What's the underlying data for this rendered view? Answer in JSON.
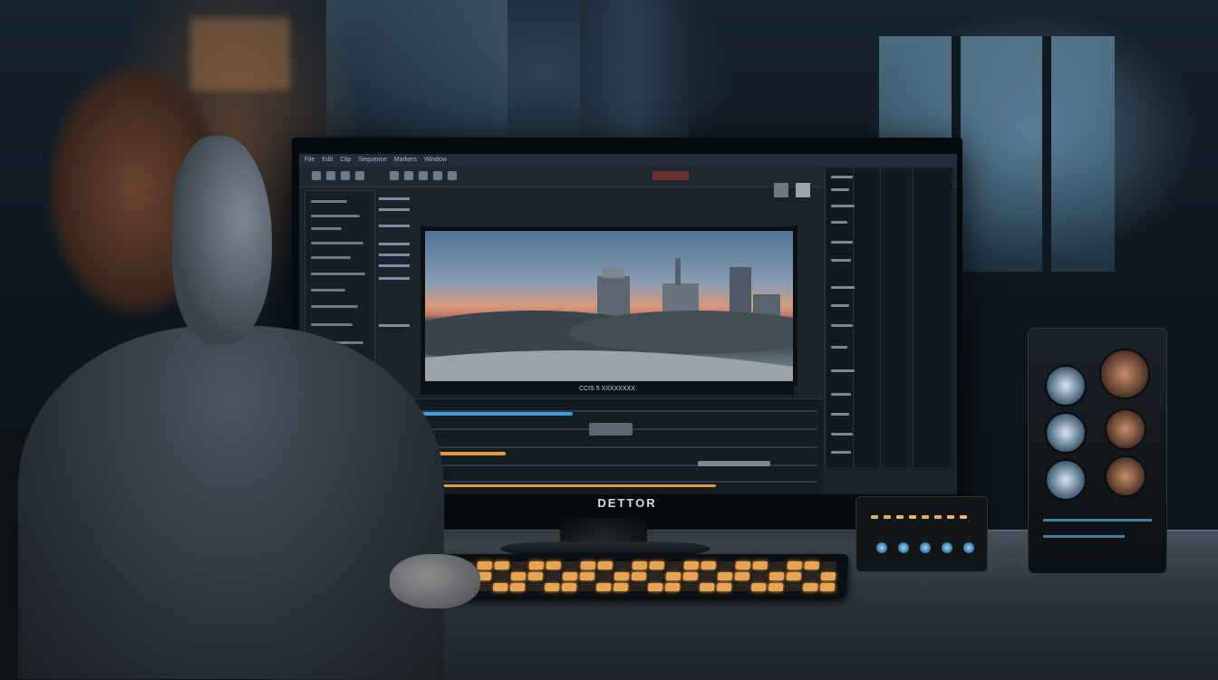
{
  "scene": {
    "monitor_brand": "DETTOR",
    "viewer_caption": "CCIS 5 XXXXXXXX",
    "menubar_items": [
      "File",
      "Edit",
      "Clip",
      "Sequence",
      "Markers",
      "Window"
    ],
    "accent_colors": {
      "timeline_blue": "#3a9fdc",
      "timeline_orange": "#e29a3c",
      "keyboard_glow": "#e7a455"
    }
  },
  "icons": [
    "play-icon",
    "cut-icon",
    "zoom-icon",
    "settings-icon"
  ]
}
